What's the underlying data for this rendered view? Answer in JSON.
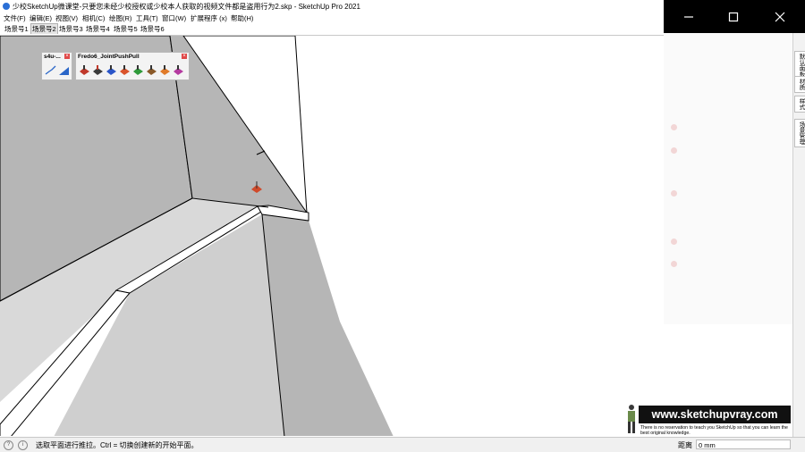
{
  "window": {
    "title": "少校SketchUp微课堂-只要您未经少校授权或少校本人获取的视频文件都是盗用行为2.skp - SketchUp Pro 2021",
    "controls": {
      "minimize": "—",
      "maximize": "☐",
      "close": "✕"
    }
  },
  "menu": [
    "文件(F)",
    "编辑(E)",
    "视图(V)",
    "相机(C)",
    "绘图(R)",
    "工具(T)",
    "窗口(W)",
    "扩展程序 (x)",
    "帮助(H)"
  ],
  "scenes": {
    "tabs": [
      "场景号1",
      "场景号2",
      "场景号3",
      "场景号4",
      "场景号5",
      "场景号6"
    ],
    "active_index": 1
  },
  "toolbars": {
    "s4u": {
      "title": "s4u-..."
    },
    "fredo": {
      "title": "Fredo6_JointPushPull"
    }
  },
  "side_tabs": [
    "默认面板",
    "材质",
    "样式",
    "场景管理"
  ],
  "status": {
    "message": "选取平面进行推拉。Ctrl = 切换创建新的开始平面。",
    "measurement_label": "距离",
    "measurement_value": "0 mm"
  },
  "watermark": {
    "logo": "www.sketchupvray.com",
    "tagline": "There is no reservation to teach you SketchUp so that you can learn the best original knowledge."
  },
  "colors": {
    "wall_gray": "#b6b6b6",
    "floor_gray": "#d9d9d9",
    "edge": "#000000",
    "window_controls_bg": "#000000"
  }
}
